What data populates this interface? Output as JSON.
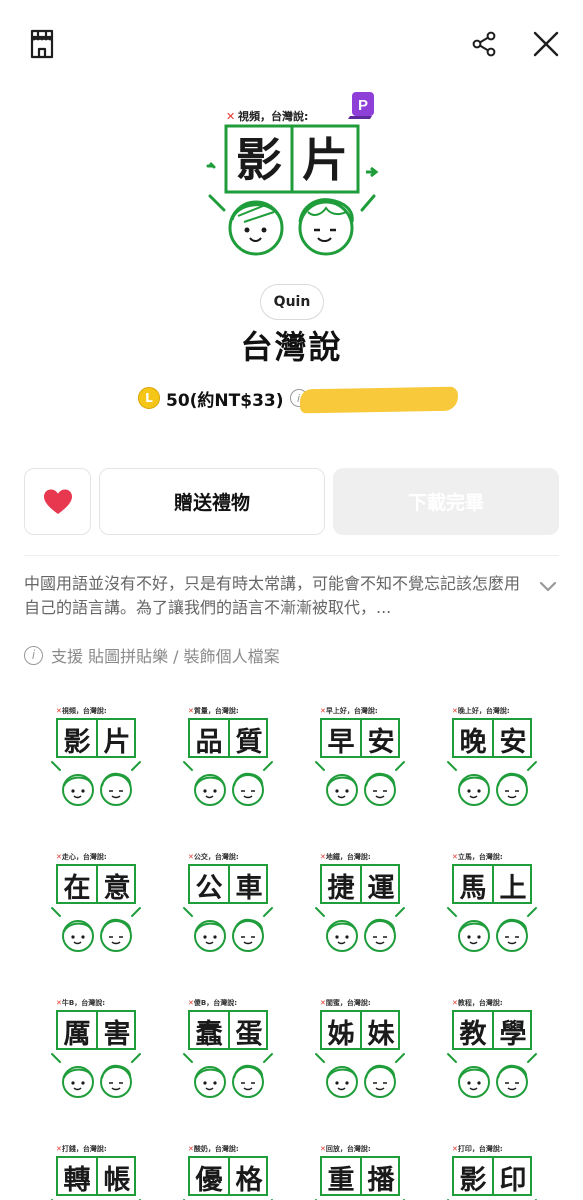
{
  "topbar": {
    "shop_icon": "shop-icon",
    "share_icon": "share-icon",
    "close_icon": "close-icon"
  },
  "hero": {
    "label_prefix": "✕",
    "label": "視頻，台灣說:",
    "chars": [
      "影",
      "片"
    ],
    "badge": "P"
  },
  "author": "Quin",
  "title": "台灣說",
  "price": {
    "coin_symbol": "L",
    "text": "50(約NT$33)"
  },
  "actions": {
    "gift_label": "贈送禮物",
    "download_label": "下載完畢"
  },
  "description": "中國用語並沒有不好，只是有時太常講，可能會不知不覺忘記該怎麼用自己的語言講。為了讓我們的語言不漸漸被取代，...",
  "support_text": "支援 貼圖拼貼樂 / 裝飾個人檔案",
  "colors": {
    "accent_green": "#1f9d3a",
    "heart": "#e8384f",
    "coin": "#f5c518",
    "badge_purple": "#8e3fd8"
  },
  "stickers": [
    {
      "label": "視頻，台灣說:",
      "chars": [
        "影",
        "片"
      ]
    },
    {
      "label": "質量，台灣說:",
      "chars": [
        "品",
        "質"
      ]
    },
    {
      "label": "早上好，台灣說:",
      "chars": [
        "早",
        "安"
      ]
    },
    {
      "label": "晚上好，台灣說:",
      "chars": [
        "晚",
        "安"
      ]
    },
    {
      "label": "走心，台灣說:",
      "chars": [
        "在",
        "意"
      ]
    },
    {
      "label": "公交，台灣說:",
      "chars": [
        "公",
        "車"
      ]
    },
    {
      "label": "地鐵，台灣說:",
      "chars": [
        "捷",
        "運"
      ]
    },
    {
      "label": "立馬，台灣說:",
      "chars": [
        "馬",
        "上"
      ]
    },
    {
      "label": "牛B，台灣說:",
      "chars": [
        "厲",
        "害"
      ]
    },
    {
      "label": "傻B，台灣說:",
      "chars": [
        "蠢",
        "蛋"
      ]
    },
    {
      "label": "閨蜜，台灣說:",
      "chars": [
        "姊",
        "妹"
      ]
    },
    {
      "label": "教程，台灣說:",
      "chars": [
        "教",
        "學"
      ]
    },
    {
      "label": "打錢，台灣說:",
      "chars": [
        "轉",
        "帳"
      ]
    },
    {
      "label": "酸奶，台灣說:",
      "chars": [
        "優",
        "格"
      ]
    },
    {
      "label": "回放，台灣說:",
      "chars": [
        "重",
        "播"
      ]
    },
    {
      "label": "打印，台灣說:",
      "chars": [
        "影",
        "印"
      ]
    }
  ]
}
